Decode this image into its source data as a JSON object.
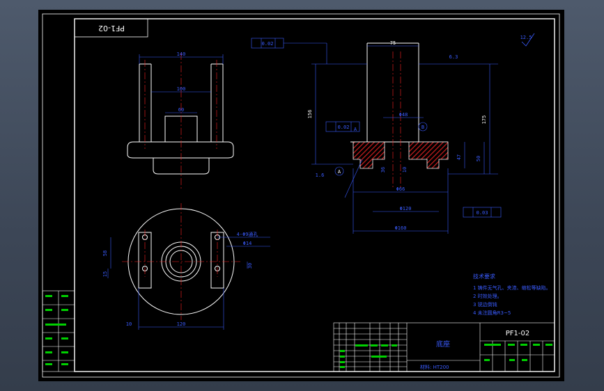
{
  "title_block": {
    "drawing_number": "PF1-02",
    "part_name": "底座",
    "material": "材料: HT200",
    "mirrored_code": "PF1-02"
  },
  "technical_requirements": {
    "heading": "技术要求",
    "items": [
      "1  铸件无气孔、夹渣、缩松等缺陷。",
      "2  时效处理。",
      "3  锐边倒钝",
      "4  未注圆角R3~5"
    ]
  },
  "dimensions": {
    "top_width": "140",
    "inner_width": "100",
    "boss_width": "60",
    "side_width": "75",
    "height_156": "156",
    "height_175": "175",
    "gdt_top": "0.02",
    "gdt_mid": "0.02",
    "gdt_bottom": "0.03",
    "datum_a": "A",
    "datum_b": "B",
    "d48": "Φ48",
    "d66": "Φ66",
    "d120": "Φ120",
    "d160": "Φ160",
    "h47": "47",
    "h50": "50",
    "d36": "36",
    "d10": "10",
    "plan_120": "120",
    "plan_10": "10",
    "plan_30": "30",
    "plan_58": "58",
    "plan_15": "15",
    "holes_note": "4-Φ9通孔",
    "holes_depth": "Φ14",
    "rough": "6.3",
    "roughness_general": "12.5",
    "chamfer": "1.6"
  },
  "colors": {
    "frame": "#ffffff",
    "part": "#ffffff",
    "centerline": "#ff2020",
    "dimension": "#3a5cff",
    "hatch": "#d02020",
    "title_green": "#00d000"
  }
}
